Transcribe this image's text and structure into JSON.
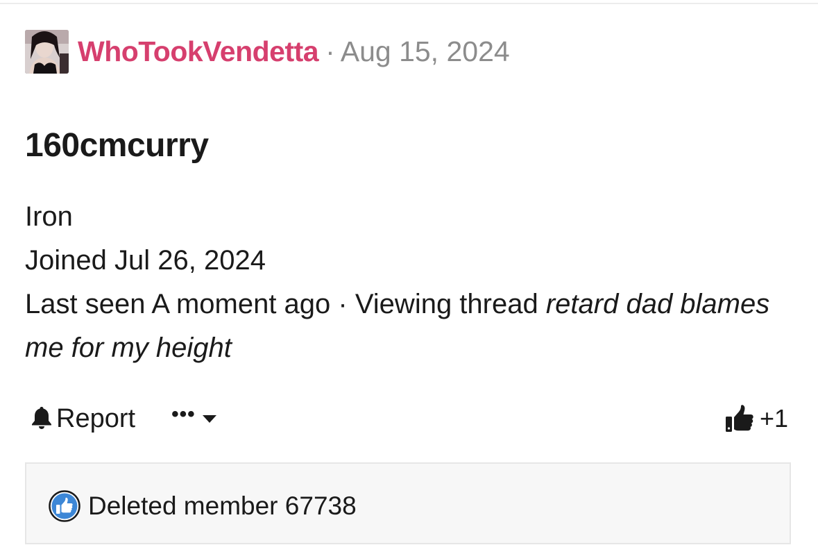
{
  "post": {
    "author": "WhoTookVendetta",
    "separator": "·",
    "date": "Aug 15, 2024"
  },
  "member": {
    "username": "160cmcurry",
    "rank": "Iron",
    "joined": "Joined Jul 26, 2024",
    "last_seen_prefix": "Last seen A moment ago · Viewing thread ",
    "thread_title": "retard dad blames me for my height"
  },
  "actions": {
    "report_label": "Report",
    "more_label": "•••",
    "like_count": "+1"
  },
  "reactions": {
    "users": "Deleted member 67738"
  },
  "colors": {
    "author": "#d63f6e",
    "muted": "#8c8c8c",
    "text": "#1a1a1a",
    "like_badge": "#3d87d6"
  },
  "icons": {
    "report": "bell-icon",
    "more": "chevron-down-icon",
    "like": "thumbs-up-icon",
    "reaction": "like-badge-icon"
  }
}
